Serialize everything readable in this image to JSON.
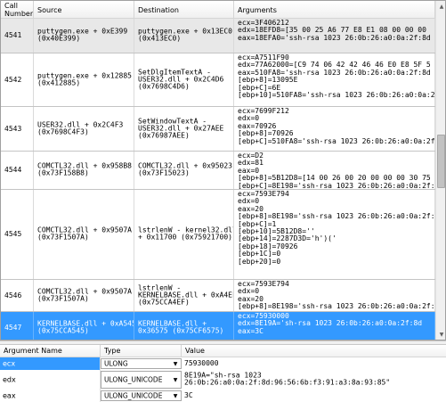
{
  "calls_table": {
    "headers": {
      "call_number": "Call\nNumber",
      "source": "Source",
      "destination": "Destination",
      "arguments": "Arguments"
    },
    "rows": [
      {
        "number": "4541",
        "source": "puttygen.exe + 0xE399\n(0x40E399)",
        "destination": "puttygen.exe + 0x13EC0\n(0x413EC0)",
        "args": [
          "ecx=3F406212",
          "edx=18EFD8=[35 00 25 A6 77 E8 E1 08 00 00 00",
          "eax=18EFA0='ssh-rsa 1023 26:0b:26:a0:0a:2f:8d"
        ],
        "state": "highlighted"
      },
      {
        "number": "4542",
        "source": "puttygen.exe + 0x12885\n(0x412885)",
        "destination": "SetDlgItemTextA -\nUSER32.dll + 0x2C4D6\n(0x7698C4D6)",
        "args": [
          "ecx=A7511F90",
          "edx=77A62000=[C9 74 06 42 42 46 46 E0 E8 5F 5",
          "eax=510FA8='ssh-rsa 1023 26:0b:26:a0:0a:2f:8d",
          "[ebp+8]=13095E",
          "[ebp+C]=6E",
          "[ebp+10]=510FA8='ssh-rsa 1023 26:0b:26:a0:0a:2f"
        ],
        "state": ""
      },
      {
        "number": "4543",
        "source": "USER32.dll + 0x2C4F3\n(0x7698C4F3)",
        "destination": "SetWindowTextA -\nUSER32.dll + 0x27AEE\n(0x76987AEE)",
        "args": [
          "ecx=7699F212",
          "edx=0",
          "eax=70926",
          "[ebp+8]=70926",
          "[ebp+C]=510FA8='ssh-rsa 1023 26:0b:26:a0:0a:2f:"
        ],
        "state": ""
      },
      {
        "number": "4544",
        "source": "COMCTL32.dll + 0x958B8\n(0x73F158B8)",
        "destination": "COMCTL32.dll + 0x95023\n(0x73F15023)",
        "args": [
          "ecx=D2",
          "edx=81",
          "eax=0",
          "[ebp+8]=5B12D8=[14 00 26 00 20 00 00 00 30 75",
          "[ebp+C]=8E198='ssh-rsa 1023 26:0b:26:a0:0a:2f:"
        ],
        "state": ""
      },
      {
        "number": "4545",
        "source": "COMCTL32.dll + 0x9507A\n(0x73F1507A)",
        "destination": "lstrlenW - kernel32.dll\n+ 0x11700 (0x75921700)",
        "args": [
          "ecx=7593E794",
          "edx=0",
          "eax=20",
          "[ebp+8]=8E198='ssh-rsa 1023 26:0b:26:a0:0a:2f:",
          "[ebp+C]=1",
          "[ebp+10]=5B12D8=''",
          "[ebp+14]=2287D3D='h')('",
          "[ebp+18]=70926",
          "[ebp+1C]=0",
          "[ebp+20]=0"
        ],
        "state": ""
      },
      {
        "number": "4546",
        "source": "COMCTL32.dll + 0x9507A\n(0x73F1507A)",
        "destination": "lstrlenW -\nKERNELBASE.dll + 0xA4EF\n(0x75CCA4EF)",
        "args": [
          "ecx=7593E794",
          "edx=0",
          "eax=20",
          "[ebp+8]=8E198='ssh-rsa 1023 26:0b:26:a0:0a:2f:"
        ],
        "state": ""
      },
      {
        "number": "4547",
        "source": "KERNELBASE.dll + 0xA545\n(0x75CCA545)",
        "destination": "KERNELBASE.dll +\n0x36575 (0x75CF6575)",
        "args": [
          "ecx=75930000",
          "edx=8E19A='sh-rsa 1023 26:0b:26:a0:0a:2f:8d",
          "eax=3C"
        ],
        "state": "selected"
      }
    ]
  },
  "arguments_grid": {
    "headers": {
      "name": "Argument Name",
      "type": "Type",
      "value": "Value"
    },
    "rows": [
      {
        "name": "ecx",
        "type": "ULONG",
        "value": "75930000",
        "selected": true
      },
      {
        "name": "edx",
        "type": "ULONG_UNICODE",
        "value": "8E19A=\"sh-rsa 1023\n26:0b:26:a0:0a:2f:8d:96:56:6b:f3:91:a3:8a:93:85\"",
        "selected": false
      },
      {
        "name": "eax",
        "type": "ULONG_UNICODE",
        "value": "3C",
        "selected": false
      }
    ]
  },
  "icons": {
    "scroll_up": "arrow-up-icon",
    "scroll_down": "arrow-down-icon",
    "dropdown": "chevron-down-icon"
  },
  "colors": {
    "selection": "#3399ff",
    "highlight_row": "#e8e8e8"
  }
}
